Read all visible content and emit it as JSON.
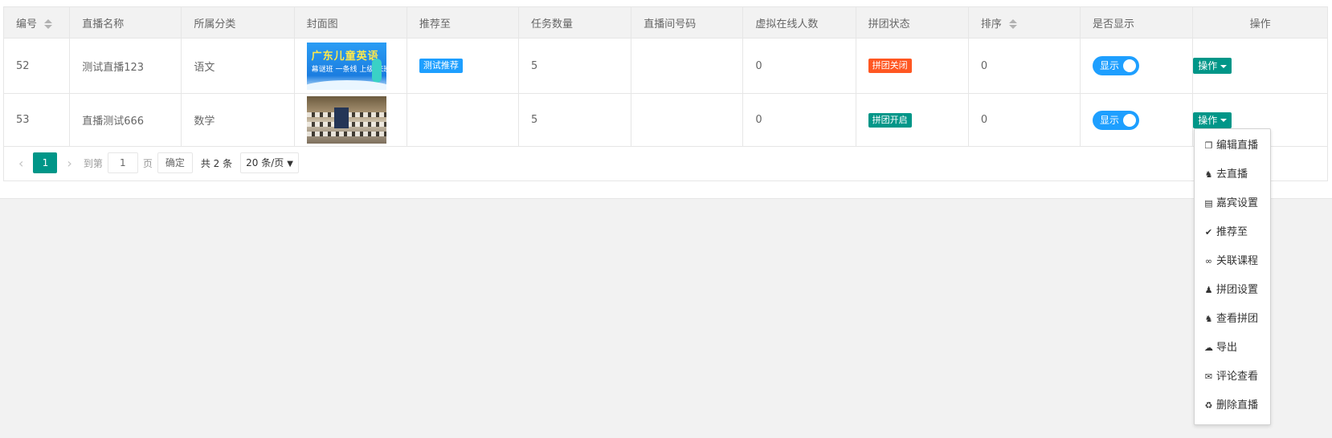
{
  "table": {
    "headers": [
      "编号",
      "直播名称",
      "所属分类",
      "封面图",
      "推荐至",
      "任务数量",
      "直播间号码",
      "虚拟在线人数",
      "拼团状态",
      "排序",
      "是否显示",
      "操作"
    ],
    "rows": [
      {
        "id": "52",
        "name": "测试直播123",
        "category": "语文",
        "cover_title": "广东儿童英语",
        "cover_sub": "幕谜班  一条线  上级 来班",
        "recommend": "测试推荐",
        "tasks": "5",
        "room": "",
        "online": "0",
        "group_status": "拼团关闭",
        "group_color": "#ff5722",
        "sort": "0",
        "show": "显示",
        "op": "操作"
      },
      {
        "id": "53",
        "name": "直播测试666",
        "category": "数学",
        "recommend": "",
        "tasks": "5",
        "room": "",
        "online": "0",
        "group_status": "拼团开启",
        "group_color": "#009688",
        "sort": "0",
        "show": "显示",
        "op": "操作"
      }
    ]
  },
  "pager": {
    "current": "1",
    "goto_label": "到第",
    "goto_value": "1",
    "page_label": "页",
    "confirm": "确定",
    "total": "共 2 条",
    "page_size": "20 条/页"
  },
  "menu": {
    "items": [
      {
        "label": "编辑直播",
        "icon": "copy-icon"
      },
      {
        "label": "去直播",
        "icon": "joystick-icon"
      },
      {
        "label": "嘉宾设置",
        "icon": "id-card-icon"
      },
      {
        "label": "推荐至",
        "icon": "check-circle-icon"
      },
      {
        "label": "关联课程",
        "icon": "link-icon"
      },
      {
        "label": "拼团设置",
        "icon": "users-icon"
      },
      {
        "label": "查看拼团",
        "icon": "joystick-icon"
      },
      {
        "label": "导出",
        "icon": "cloud-download-icon"
      },
      {
        "label": "评论查看",
        "icon": "comment-icon"
      },
      {
        "label": "删除直播",
        "icon": "trash-icon"
      }
    ]
  },
  "colors": {
    "primary": "#009688",
    "accent": "#1e9fff",
    "danger": "#ff5722"
  }
}
